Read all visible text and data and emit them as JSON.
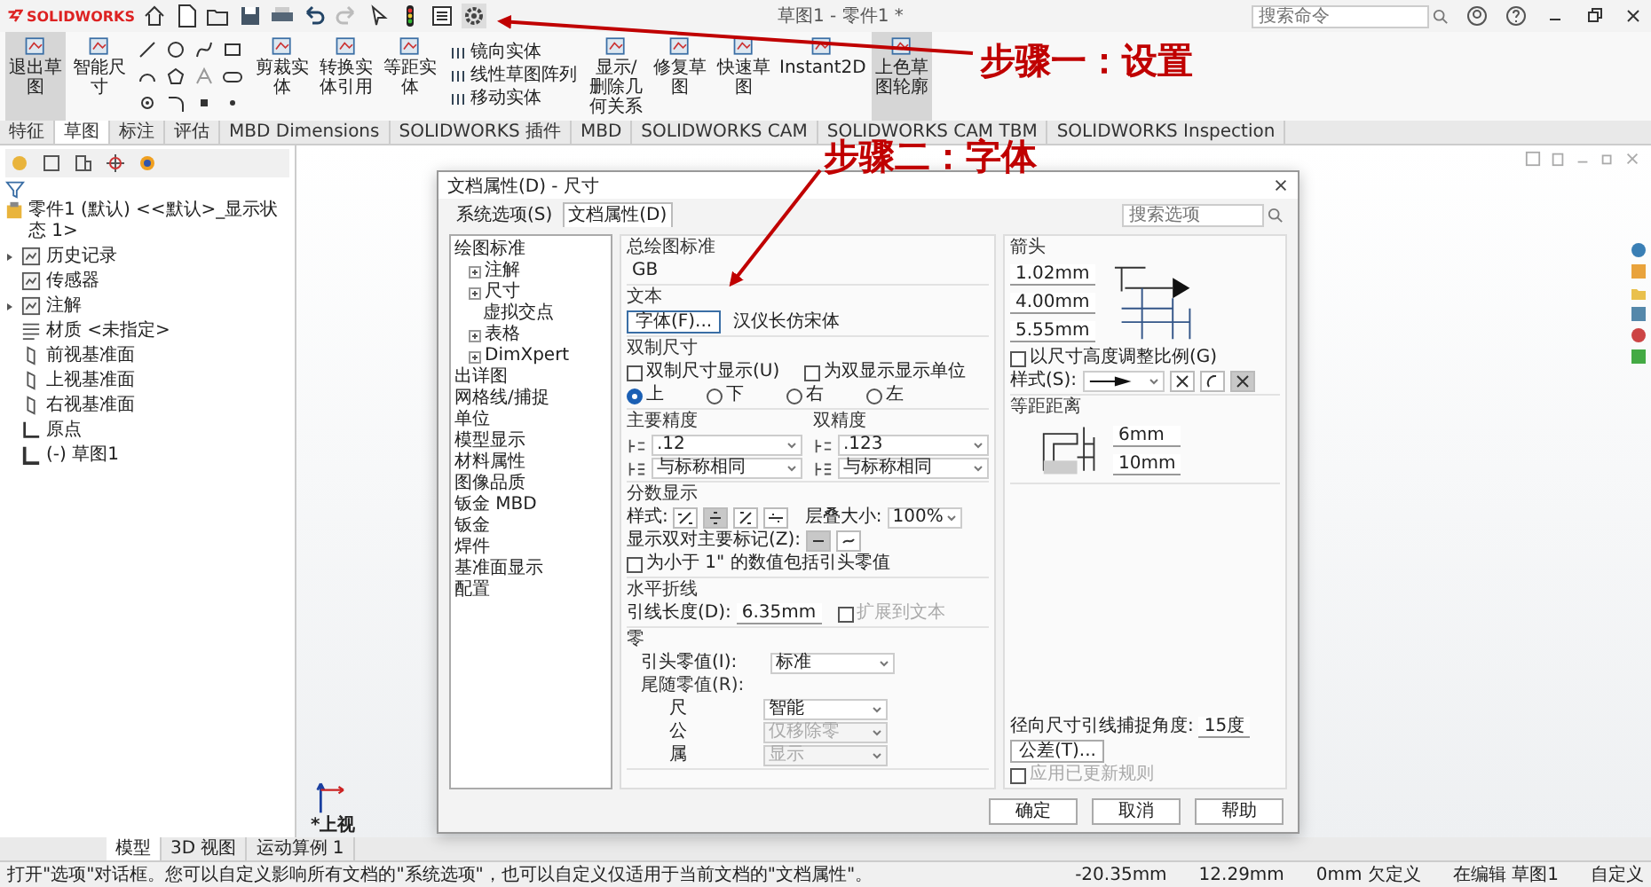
{
  "title_bar": {
    "logo": "SOLIDWORKS",
    "title": "草图1 - 零件1 *",
    "search": {
      "placeholder": "搜索命令"
    }
  },
  "ribbon": [
    {
      "kind": "big",
      "label": "退出草图",
      "on": true
    },
    {
      "kind": "big",
      "label": "智能尺寸",
      "on": false
    },
    {
      "kind": "tools"
    },
    {
      "kind": "big",
      "label": "剪裁实体",
      "on": false
    },
    {
      "kind": "big",
      "label": "转换实体引用",
      "on": false
    },
    {
      "kind": "big",
      "label": "等距实体",
      "on": false
    },
    {
      "kind": "stack",
      "entries": [
        "镜向实体",
        "线性草图阵列",
        "移动实体"
      ]
    },
    {
      "kind": "big",
      "label": "显示/删除几何关系",
      "on": false
    },
    {
      "kind": "big",
      "label": "修复草图",
      "on": false
    },
    {
      "kind": "big",
      "label": "快速草图",
      "on": false
    },
    {
      "kind": "big",
      "label": "Instant2D",
      "on": false
    },
    {
      "kind": "big",
      "label": "上色草图轮廓",
      "on": true
    }
  ],
  "annotations": [
    "步骤一：设置",
    "步骤二：字体"
  ],
  "command_tabs": [
    {
      "label": "特征",
      "selected": false
    },
    {
      "label": "草图",
      "selected": true
    },
    {
      "label": "标注",
      "selected": false
    },
    {
      "label": "评估",
      "selected": false
    },
    {
      "label": "MBD Dimensions",
      "selected": false
    },
    {
      "label": "SOLIDWORKS 插件",
      "selected": false
    },
    {
      "label": "MBD",
      "selected": false
    },
    {
      "label": "SOLIDWORKS CAM",
      "selected": false
    },
    {
      "label": "SOLIDWORKS CAM TBM",
      "selected": false
    },
    {
      "label": "SOLIDWORKS Inspection",
      "selected": false
    }
  ],
  "feature_tree": {
    "root": "零件1 (默认) <<默认>_显示状态 1>",
    "items": [
      {
        "label": "历史记录",
        "kind": "folder",
        "expandable": true
      },
      {
        "label": "传感器",
        "kind": "sensor",
        "expandable": false
      },
      {
        "label": "注解",
        "kind": "annotation",
        "expandable": true
      },
      {
        "label": "材质 <未指定>",
        "kind": "material",
        "expandable": false
      },
      {
        "label": "前视基准面",
        "kind": "plane",
        "expandable": false
      },
      {
        "label": "上视基准面",
        "kind": "plane",
        "expandable": false
      },
      {
        "label": "右视基准面",
        "kind": "plane",
        "expandable": false
      },
      {
        "label": "原点",
        "kind": "origin",
        "expandable": false
      },
      {
        "label": "(-) 草图1",
        "kind": "sketch",
        "expandable": false
      }
    ]
  },
  "canvas": {
    "view_label": "*上视"
  },
  "dialog": {
    "title": "文档属性(D) - 尺寸",
    "tabs": [
      {
        "label": "系统选项(S)",
        "selected": false
      },
      {
        "label": "文档属性(D)",
        "selected": true
      }
    ],
    "search": {
      "placeholder": "搜索选项"
    },
    "tree": [
      {
        "label": "绘图标准",
        "expandable": false,
        "children": [
          {
            "label": "注解",
            "expandable": true
          },
          {
            "label": "尺寸",
            "expandable": true,
            "children": [
              {
                "label": "虚拟交点",
                "expandable": false
              }
            ]
          },
          {
            "label": "表格",
            "expandable": true
          },
          {
            "label": "DimXpert",
            "expandable": true
          }
        ]
      },
      {
        "label": "出详图",
        "expandable": false
      },
      {
        "label": "网格线/捕捉",
        "expandable": false
      },
      {
        "label": "单位",
        "expandable": false
      },
      {
        "label": "模型显示",
        "expandable": false
      },
      {
        "label": "材料属性",
        "expandable": false
      },
      {
        "label": "图像品质",
        "expandable": false
      },
      {
        "label": "钣金 MBD",
        "expandable": false
      },
      {
        "label": "钣金",
        "expandable": false
      },
      {
        "label": "焊件",
        "expandable": false
      },
      {
        "label": "基准面显示",
        "expandable": false
      },
      {
        "label": "配置",
        "expandable": false
      }
    ],
    "overall_standard": {
      "heading": "总绘图标准",
      "value": "GB"
    },
    "text": {
      "heading": "文本",
      "font_button": "字体(F)...",
      "font_name": "汉仪长仿宋体"
    },
    "dual": {
      "heading": "双制尺寸",
      "checks": [
        {
          "label": "双制尺寸显示(U)",
          "checked": false
        },
        {
          "label": "为双显示显示单位",
          "checked": false
        }
      ],
      "positions": [
        {
          "label": "上",
          "selected": true
        },
        {
          "label": "下",
          "selected": false
        },
        {
          "label": "右",
          "selected": false
        },
        {
          "label": "左",
          "selected": false
        }
      ]
    },
    "precision": [
      {
        "heading": "主要精度",
        "value": ".12",
        "tolerance": "与标称相同"
      },
      {
        "heading": "双精度",
        "value": ".123",
        "tolerance": "与标称相同"
      }
    ],
    "fraction": {
      "heading": "分数显示",
      "style_label": "样式:",
      "styles": [
        {
          "selected": false
        },
        {
          "selected": true
        },
        {
          "selected": false
        },
        {
          "selected": false
        }
      ],
      "stack_label": "层叠大小:",
      "stack_size": "100%",
      "dual_label": "显示双对主要标记(Z):",
      "dual_marks": [
        {
          "selected": true
        },
        {
          "selected": false
        }
      ],
      "leading_zero": {
        "label": "为小于 1\" 的数值包括引头零值",
        "checked": false
      }
    },
    "bent_leader": {
      "heading": "水平折线",
      "length_label": "引线长度(D):",
      "length": "6.35mm",
      "extend": {
        "label": "扩展到文本",
        "checked": false,
        "disabled": true
      }
    },
    "zeros": {
      "heading": "零",
      "leading_label": "引头零值(I):",
      "leading": "标准",
      "trailing_label": "尾随零值(R):",
      "rows": [
        {
          "label": "尺",
          "value": "智能",
          "disabled": false
        },
        {
          "label": "公",
          "value": "仅移除零",
          "disabled": true
        },
        {
          "label": "属",
          "value": "显示",
          "disabled": true
        }
      ]
    },
    "arrows": {
      "heading": "箭头",
      "sizes": [
        "1.02mm",
        "4.00mm",
        "5.55mm"
      ],
      "scale": {
        "label": "以尺寸高度调整比例(G)",
        "checked": false
      },
      "style_label": "样式(S):",
      "buttons": [
        {
          "selected": false
        },
        {
          "selected": false
        },
        {
          "selected": true
        }
      ]
    },
    "offset": {
      "heading": "等距距离",
      "values": [
        "6mm",
        "10mm"
      ]
    },
    "radial": {
      "label": "径向尺寸引线捕捉角度:",
      "value": "15度"
    },
    "tolerance_button": "公差(T)...",
    "apply_rules": {
      "label": "应用已更新规则",
      "checked": false,
      "disabled": true
    },
    "buttons": [
      "确定",
      "取消",
      "帮助"
    ]
  },
  "bottom_tabs": [
    {
      "label": "模型",
      "selected": true
    },
    {
      "label": "3D 视图",
      "selected": false
    },
    {
      "label": "运动算例 1",
      "selected": false
    }
  ],
  "status_bar": {
    "message": "打开\"选项\"对话框。您可以自定义影响所有文档的\"系统选项\"，也可以自定义仅适用于当前文档的\"文档属性\"。",
    "fields": [
      "-20.35mm",
      "12.29mm",
      "0mm 欠定义",
      "在编辑 草图1",
      "自定义"
    ]
  }
}
